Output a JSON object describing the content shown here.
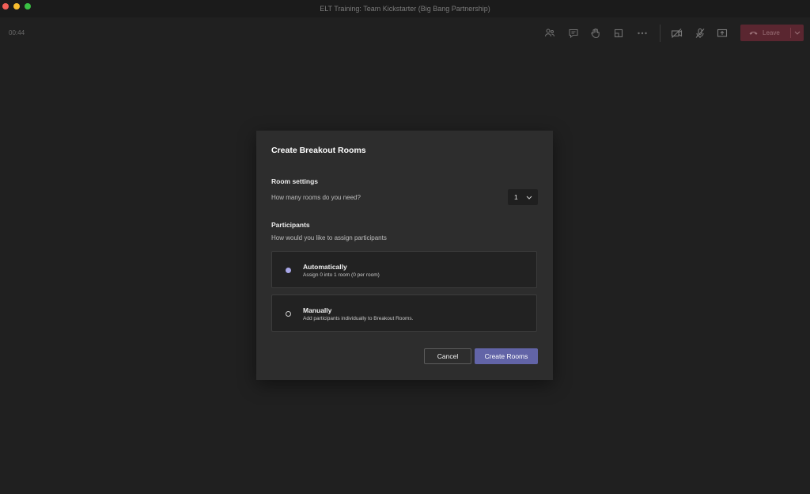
{
  "window": {
    "title": "ELT Training: Team Kickstarter (Big Bang Partnership)"
  },
  "toolbar": {
    "timer": "00:44",
    "icons": [
      "people-icon",
      "chat-icon",
      "raise-hand-icon",
      "breakout-rooms-icon",
      "more-options-icon",
      "camera-off-icon",
      "mic-off-icon",
      "share-screen-icon"
    ],
    "leave_label": "Leave",
    "leave_color": "#5a2630"
  },
  "dialog": {
    "title": "Create Breakout Rooms",
    "room_settings": {
      "heading": "Room settings",
      "question": "How many rooms do you need?",
      "rooms_value": "1"
    },
    "participants": {
      "heading": "Participants",
      "question": "How would you like to assign participants",
      "options": [
        {
          "label": "Automatically",
          "description": "Assign 0 into 1 room (0 per room)",
          "selected": true
        },
        {
          "label": "Manually",
          "description": "Add participants individually to Breakout Rooms.",
          "selected": false
        }
      ]
    },
    "cancel_label": "Cancel",
    "create_label": "Create Rooms",
    "accent_color": "#6264a7"
  }
}
